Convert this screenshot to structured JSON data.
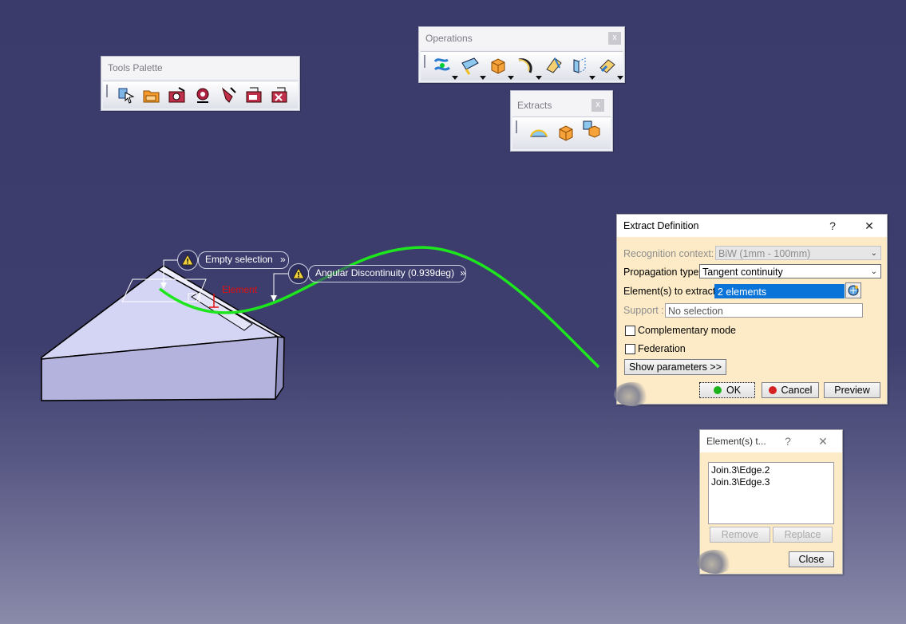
{
  "tools_palette": {
    "title": "Tools Palette",
    "icons": [
      "select-icon",
      "open-folder-icon",
      "capture-icon",
      "inspect-icon",
      "measure-icon",
      "edit-point-icon",
      "close-edit-icon"
    ]
  },
  "operations": {
    "title": "Operations",
    "close": "x",
    "icons": [
      "join-icon",
      "heal-icon",
      "extract-icon",
      "fillet-icon",
      "transform-icon",
      "extrapolate-icon",
      "untrim-icon"
    ]
  },
  "extracts": {
    "title": "Extracts",
    "close": "x",
    "icons": [
      "boundary-icon",
      "extract-icon",
      "multiple-extract-icon"
    ]
  },
  "viewport": {
    "callout_empty": "Empty selection",
    "callout_angular": "Angular Discontinuity (0.939deg)",
    "chevrons": "»",
    "element_label": "Element",
    "colors": {
      "curve": "#1ee61e",
      "part": "#c9c9ef",
      "label_red": "#e01010"
    }
  },
  "extract_definition": {
    "title": "Extract Definition",
    "help": "?",
    "close": "✕",
    "recognition_label": "Recognition context:",
    "recognition_value": "BiW (1mm - 100mm)",
    "propagation_label": "Propagation type:",
    "propagation_value": "Tangent continuity",
    "elements_label": "Element(s) to extract:",
    "elements_value": "2 elements",
    "support_label": "Support :",
    "support_value": "No selection",
    "complementary_label": "Complementary mode",
    "federation_label": "Federation",
    "show_params": "Show parameters >>",
    "ok": "OK",
    "cancel": "Cancel",
    "preview": "Preview"
  },
  "elements_dialog": {
    "title": "Element(s) t...",
    "help": "?",
    "close": "✕",
    "items": [
      "Join.3\\Edge.2",
      "Join.3\\Edge.3"
    ],
    "remove": "Remove",
    "replace": "Replace",
    "close_btn": "Close"
  }
}
